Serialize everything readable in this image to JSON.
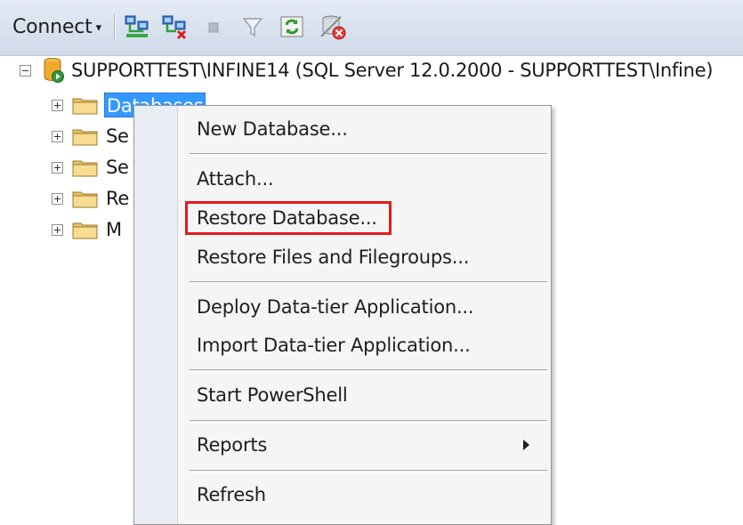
{
  "toolbar": {
    "connect_label": "Connect",
    "caret": "▾",
    "icons": [
      "connect-object-explorer-icon",
      "disconnect-icon",
      "stop-icon",
      "filter-icon",
      "refresh-icon",
      "disconnect-all-icon"
    ]
  },
  "tree": {
    "server": {
      "label": "SUPPORTTEST\\INFINE14 (SQL Server 12.0.2000 - SUPPORTTEST\\Infine)",
      "expanded": true
    },
    "folders": [
      {
        "label": "Databases",
        "selected": true
      },
      {
        "label": "Se"
      },
      {
        "label": "Se"
      },
      {
        "label": "Re"
      },
      {
        "label": "M"
      }
    ]
  },
  "context_menu": {
    "items": [
      {
        "label": "New Database..."
      },
      {
        "label": "Attach..."
      },
      {
        "label": "Restore Database...",
        "highlighted": true
      },
      {
        "label": "Restore Files and Filegroups..."
      },
      {
        "label": "Deploy Data-tier Application..."
      },
      {
        "label": "Import Data-tier Application..."
      },
      {
        "label": "Start PowerShell"
      },
      {
        "label": "Reports",
        "has_submenu": true
      },
      {
        "label": "Refresh"
      }
    ]
  },
  "colors": {
    "selection": "#3399ff",
    "highlight_border": "#e21b1b",
    "toolbar_bg": "#d8e1ee"
  }
}
